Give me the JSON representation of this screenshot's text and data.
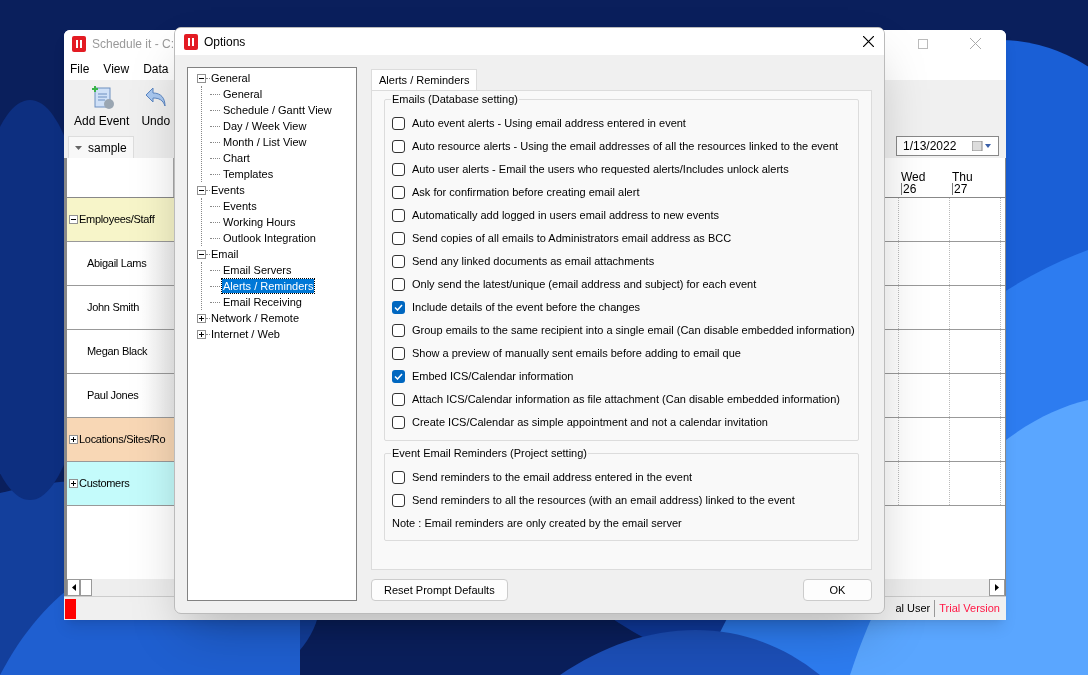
{
  "background_window": {
    "title": "Schedule it - C:",
    "menu": [
      "File",
      "View",
      "Data"
    ],
    "toolbar": [
      {
        "label": "Add Event",
        "kind": "add"
      },
      {
        "label": "Undo",
        "kind": "undo"
      }
    ],
    "tab": "sample",
    "date": "1/13/2022",
    "days": [
      {
        "day": "Wed",
        "date": "26"
      },
      {
        "day": "Thu",
        "date": "27"
      }
    ],
    "resources": [
      {
        "label": "Employees/Staff",
        "kind": "group",
        "expanded": true,
        "color": "#f7f5c9"
      },
      {
        "label": "Abigail Lams",
        "kind": "person"
      },
      {
        "label": "John Smith",
        "kind": "person"
      },
      {
        "label": "Megan Black",
        "kind": "person"
      },
      {
        "label": "Paul Jones",
        "kind": "person"
      },
      {
        "label": "Locations/Sites/Ro",
        "kind": "group",
        "expanded": false,
        "color": "#f8d7b5"
      },
      {
        "label": "Customers",
        "kind": "group",
        "expanded": false,
        "color": "#c4fbfb"
      }
    ],
    "status": [
      {
        "text": "al User",
        "kind": "normal"
      },
      {
        "text": "Trial Version",
        "kind": "warning"
      }
    ]
  },
  "options_dialog": {
    "title": "Options",
    "tree": [
      {
        "label": "General",
        "expanded": true,
        "selected": false,
        "children": [
          {
            "label": "General",
            "selected": false
          },
          {
            "label": "Schedule / Gantt View",
            "selected": false
          },
          {
            "label": "Day / Week View",
            "selected": false
          },
          {
            "label": "Month / List View",
            "selected": false
          },
          {
            "label": "Chart",
            "selected": false
          },
          {
            "label": "Templates",
            "selected": false
          }
        ]
      },
      {
        "label": "Events",
        "expanded": true,
        "selected": false,
        "children": [
          {
            "label": "Events",
            "selected": false
          },
          {
            "label": "Working Hours",
            "selected": false
          },
          {
            "label": "Outlook Integration",
            "selected": false
          }
        ]
      },
      {
        "label": "Email",
        "expanded": true,
        "selected": false,
        "children": [
          {
            "label": "Email Servers",
            "selected": false
          },
          {
            "label": "Alerts / Reminders",
            "selected": true
          },
          {
            "label": "Email Receiving",
            "selected": false
          }
        ]
      },
      {
        "label": "Network / Remote",
        "expanded": false,
        "selected": false
      },
      {
        "label": "Internet / Web",
        "expanded": false,
        "selected": false
      }
    ],
    "tab": "Alerts / Reminders",
    "groups": [
      {
        "title": "Emails (Database setting)",
        "options": [
          {
            "label": "Auto event alerts - Using email address entered in event",
            "checked": false
          },
          {
            "label": "Auto resource alerts - Using the email addresses of all the resources linked to the event",
            "checked": false
          },
          {
            "label": "Auto user alerts - Email the users who requested alerts/Includes unlock alerts",
            "checked": false
          },
          {
            "label": "Ask for confirmation before creating email alert",
            "checked": false
          },
          {
            "label": "Automatically add logged in users email address to new events",
            "checked": false
          },
          {
            "label": "Send copies of all emails to Administrators email address as BCC",
            "checked": false
          },
          {
            "label": "Send any linked documents as email attachments",
            "checked": false
          },
          {
            "label": "Only send the latest/unique (email address and subject) for each event",
            "checked": false
          },
          {
            "label": "Include details of the event before the changes",
            "checked": true
          },
          {
            "label": "Group emails to the same recipient into a single email (Can disable embedded information)",
            "checked": false
          },
          {
            "label": "Show a preview of manually sent emails before adding to email que",
            "checked": false
          },
          {
            "label": "Embed ICS/Calendar information",
            "checked": true
          },
          {
            "label": "Attach ICS/Calendar information as file attachment (Can disable embedded information)",
            "checked": false
          },
          {
            "label": "Create ICS/Calendar as simple appointment and not a calendar invitation",
            "checked": false
          }
        ]
      },
      {
        "title": "Event Email Reminders (Project setting)",
        "options": [
          {
            "label": "Send reminders to the email address entered in the event",
            "checked": false
          },
          {
            "label": "Send reminders to all the resources (with an email address) linked to the event",
            "checked": false
          }
        ],
        "note": "Note : Email reminders are only created by the email server"
      }
    ],
    "buttons": [
      {
        "label": "Reset Prompt Defaults",
        "kind": "secondary"
      },
      {
        "label": "OK",
        "kind": "primary"
      }
    ]
  }
}
